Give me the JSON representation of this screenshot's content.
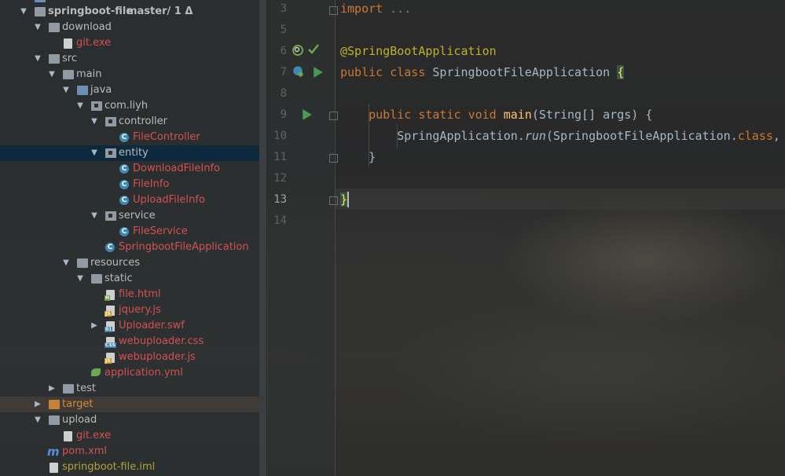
{
  "project": {
    "root_name": "springboot-file",
    "root_branch": "master/ 1 Δ",
    "items": {
      "download": "download",
      "download_git": "git.exe",
      "src": "src",
      "main": "main",
      "java": "java",
      "pkg": "com.liyh",
      "controller": "controller",
      "file_controller": "FileController",
      "entity": "entity",
      "download_file_info": "DownloadFileInfo",
      "file_info": "FileInfo",
      "upload_file_info": "UploadFileInfo",
      "service": "service",
      "file_service": "FileService",
      "app_class": "SpringbootFileApplication",
      "resources": "resources",
      "static": "static",
      "file_html": "file.html",
      "jquery": "jquery.js",
      "uploader_swf": "Uploader.swf",
      "webuploader_css": "webuploader.css",
      "webuploader_js": "webuploader.js",
      "application_yml": "application.yml",
      "test": "test",
      "target": "target",
      "upload": "upload",
      "upload_git": "git.exe",
      "pom": "pom.xml",
      "iml": "springboot-file.iml"
    },
    "icon_tags": {
      "html": "H",
      "js": "JS",
      "swf": "01",
      "css": "CSS",
      "maven": "m"
    }
  },
  "editor": {
    "line_numbers": [
      "3",
      "5",
      "6",
      "7",
      "8",
      "9",
      "10",
      "11",
      "12",
      "13",
      "14"
    ],
    "code": {
      "l3_import": "import",
      "l3_fold": "...",
      "l6_annotation": "@SpringBootApplication",
      "l7_kw1": "public",
      "l7_kw2": "class",
      "l7_name": "SpringbootFileApplication",
      "l7_brace": "{",
      "l9_kw1": "public",
      "l9_kw2": "static",
      "l9_kw3": "void",
      "l9_method": "main",
      "l9_params": "(String[] args) {",
      "l10_class": "SpringApplication.",
      "l10_method": "run",
      "l10_args": "(SpringbootFileApplication.",
      "l10_class_kw": "class",
      "l10_tail": ",",
      "l11_close": "}",
      "l13_close": "}"
    }
  },
  "colors": {
    "keyword": "#cc7832",
    "annotation": "#bbb529",
    "method": "#ffc66d",
    "selected_row": "#0d293e",
    "error_red": "#d25252"
  },
  "icons": [
    "tree-expand-icon",
    "folder-icon",
    "package-icon",
    "class-icon",
    "spring-app-icon",
    "html-file-icon",
    "js-file-icon",
    "swf-file-icon",
    "css-file-icon",
    "yml-leaf-icon",
    "maven-icon",
    "iml-file-icon",
    "run-icon",
    "spring-bean-icon"
  ]
}
